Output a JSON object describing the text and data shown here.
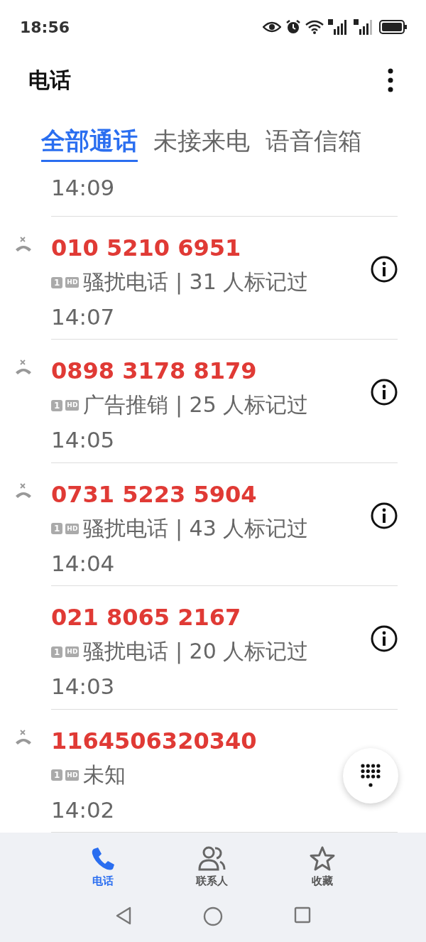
{
  "status_bar": {
    "time": "18:56"
  },
  "header": {
    "title": "电话"
  },
  "tabs": [
    {
      "label": "全部通话",
      "selected": true
    },
    {
      "label": "未接来电",
      "selected": false
    },
    {
      "label": "语音信箱",
      "selected": false
    }
  ],
  "partial_row": {
    "time": "14:09"
  },
  "calls": [
    {
      "number": "010 5210 6951",
      "missed": true,
      "sim": "1",
      "hd": "HD",
      "detail": "骚扰电话 | 31 人标记过",
      "time": "14:07",
      "info": true
    },
    {
      "number": "0898 3178 8179",
      "missed": true,
      "sim": "1",
      "hd": "HD",
      "detail": "广告推销 | 25 人标记过",
      "time": "14:05",
      "info": true
    },
    {
      "number": "0731 5223 5904",
      "missed": true,
      "sim": "1",
      "hd": "HD",
      "detail": "骚扰电话 | 43 人标记过",
      "time": "14:04",
      "info": true
    },
    {
      "number": "021 8065 2167",
      "missed": false,
      "sim": "1",
      "hd": "HD",
      "detail": "骚扰电话 | 20 人标记过",
      "time": "14:03",
      "info": true
    },
    {
      "number": "1164506320340",
      "missed": true,
      "sim": "1",
      "hd": "HD",
      "detail": "未知",
      "time": "14:02",
      "info": false
    }
  ],
  "bottom_nav": [
    {
      "kind": "phone",
      "label": "电话",
      "selected": true
    },
    {
      "kind": "contacts",
      "label": "联系人",
      "selected": false
    },
    {
      "kind": "star",
      "label": "收藏",
      "selected": false
    }
  ]
}
